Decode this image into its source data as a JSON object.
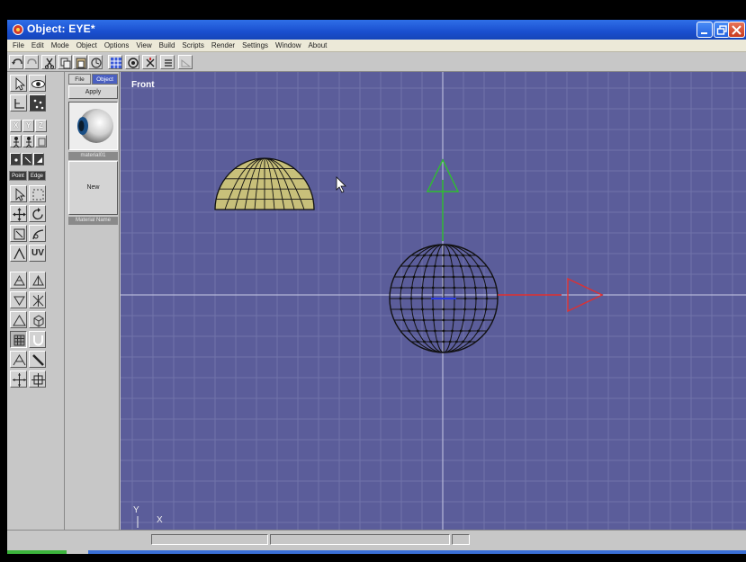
{
  "window": {
    "title": "Object: EYE*",
    "app_icon": "red-object-icon",
    "controls": [
      "minimize-icon",
      "restore-icon",
      "close-icon"
    ]
  },
  "menu": [
    "File",
    "Edit",
    "Mode",
    "Object",
    "Options",
    "View",
    "Build",
    "Scripts",
    "Render",
    "Settings",
    "Window",
    "About"
  ],
  "toolbar": {
    "icons": [
      "undo-icon",
      "redo-icon",
      "cut-icon",
      "copy-icon",
      "paste-icon",
      "lock-icon",
      "grid-icon",
      "sphere-snap-icon",
      "move-icon",
      "list-icon",
      "layer-icon"
    ]
  },
  "tools": {
    "axis_buttons": [
      "X",
      "Y",
      "Z"
    ],
    "mode_tabs": [
      "Point",
      "Edge"
    ],
    "uv_label": "UV"
  },
  "material_panel": {
    "tabs": [
      "File",
      "Object"
    ],
    "apply_label": "Apply",
    "material_name": "material01",
    "new_label": "New",
    "material_name_label": "Material Name"
  },
  "viewport": {
    "label": "Front",
    "axis_x": "X",
    "axis_y": "Y",
    "background": "#5b5d9a",
    "gridline_color": "#7073aa",
    "x_axis_color": "#e03030",
    "y_axis_color": "#2fbf2f"
  },
  "statusbar": {
    "progress": 0.08
  }
}
